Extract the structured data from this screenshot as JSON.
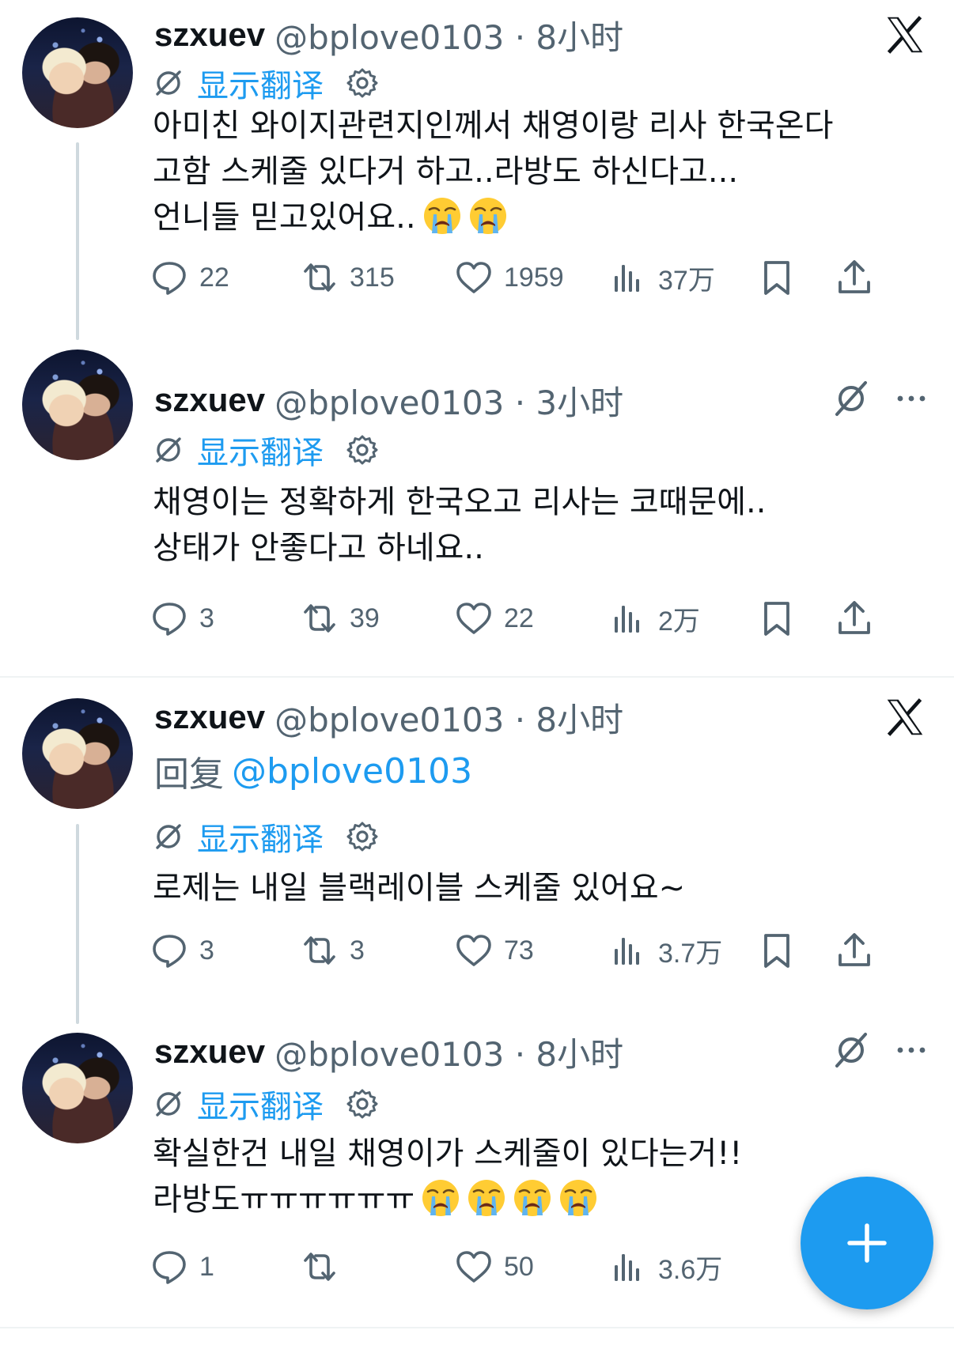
{
  "colors": {
    "accent": "#1d9bf0",
    "secondary": "#536471",
    "text": "#0f1419"
  },
  "common": {
    "display_name": "szxuev",
    "translate_label": "显示翻译",
    "translate_icon": "translate-icon",
    "settings_icon": "gear-icon"
  },
  "tweets": [
    {
      "handle_time": "@bplove0103 · 8小时",
      "reply_label": "",
      "reply_mention": "",
      "lines": [
        "아미친 와이지관련지인께서 채영이랑 리사 한국온다",
        "고함 스케줄 있다거 하고..라방도 하신다고...",
        "언니들 믿고있어요.."
      ],
      "emoji": [
        "loudly-crying-face",
        "loudly-crying-face"
      ],
      "replies": "22",
      "reposts": "315",
      "likes": "1959",
      "views": "37万",
      "corner_icon": "x-logo-icon"
    },
    {
      "handle_time": "@bplove0103 · 3小时",
      "lines": [
        "채영이는 정확하게 한국오고 리사는 코때문에..",
        "상태가 안좋다고 하네요.."
      ],
      "emoji": [],
      "replies": "3",
      "reposts": "39",
      "likes": "22",
      "views": "2万",
      "corner_icon": "grok-icon"
    },
    {
      "handle_time": "@bplove0103 · 8小时",
      "reply_label": "回复",
      "reply_mention": "@bplove0103",
      "lines": [
        "로제는 내일 블랙레이블 스케줄 있어요~"
      ],
      "emoji": [],
      "replies": "3",
      "reposts": "3",
      "likes": "73",
      "views": "3.7万",
      "corner_icon": "x-logo-icon"
    },
    {
      "handle_time": "@bplove0103 · 8小时",
      "lines": [
        "확실한건 내일 채영이가 스케줄이 있다는거!!",
        "라방도ㅠㅠㅠㅠㅠㅠ"
      ],
      "emoji": [
        "loudly-crying-face",
        "loudly-crying-face",
        "loudly-crying-face",
        "loudly-crying-face"
      ],
      "replies": "1",
      "reposts": "",
      "likes": "50",
      "views": "3.6万",
      "corner_icon": "grok-icon"
    }
  ],
  "fab": {
    "icon": "plus-icon",
    "label": "+"
  }
}
